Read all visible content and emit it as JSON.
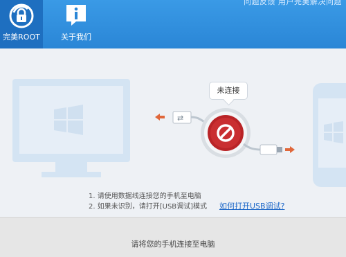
{
  "header": {
    "tabs": [
      {
        "label": "完美ROOT",
        "icon": "lock-icon",
        "active": true
      },
      {
        "label": "关于我们",
        "icon": "info-icon",
        "active": false
      }
    ],
    "note": "问题反馈 用户完美解决问题"
  },
  "connection": {
    "status_label": "未连接",
    "status_icon": "forbidden-icon",
    "accent_color": "#c0292b"
  },
  "instructions": {
    "line1": "1. 请使用数据线连接您的手机至电脑",
    "line2": "2. 如果未识别，请打开[USB调试]模式",
    "help_link": "如何打开USB调试?"
  },
  "footer": {
    "status_text": "请将您的手机连接至电脑"
  },
  "colors": {
    "header_blue": "#2a86d6",
    "active_tab": "#1e6fc0",
    "arrow_orange": "#e0673a",
    "link_blue": "#1a66c8"
  }
}
